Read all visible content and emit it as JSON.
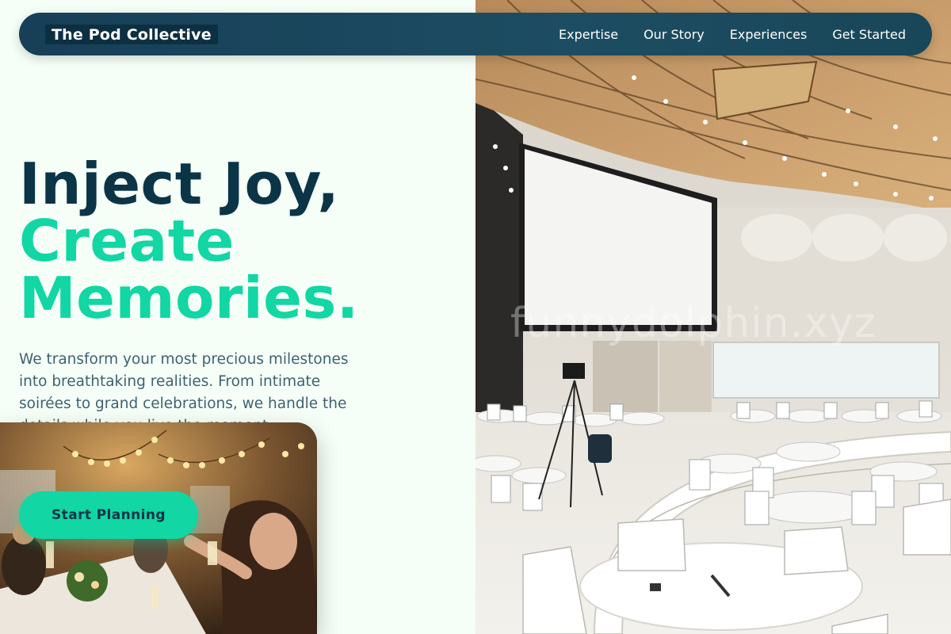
{
  "nav": {
    "brand": "The Pod Collective",
    "links": [
      "Expertise",
      "Our Story",
      "Experiences",
      "Get Started"
    ]
  },
  "hero": {
    "headline_line1": "Inject Joy,",
    "headline_line2": "Create",
    "headline_line3": "Memories.",
    "lede": "We transform your most precious milestones into breathtaking realities. From intimate soirées to grand celebrations, we handle the details while you live the moment.",
    "cta_label": "Start Planning"
  },
  "images": {
    "main_photo": "conference-hall-photo",
    "inset_photo": "celebration-toast-photo",
    "watermark": "funnydolphin.xyz"
  },
  "colors": {
    "navy": "#0b3447",
    "accent": "#12d6a3",
    "page_bg": "#f5fff7",
    "nav_bg": "#1d4d62"
  }
}
